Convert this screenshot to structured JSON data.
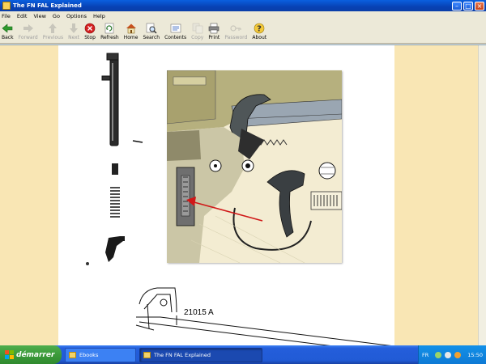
{
  "window": {
    "title": "The FN FAL Explained"
  },
  "menu": [
    "File",
    "Edit",
    "View",
    "Go",
    "Options",
    "Help"
  ],
  "toolbar": [
    {
      "name": "back",
      "label": "Back",
      "icon": "back-arrow-icon",
      "enabled": true
    },
    {
      "name": "forward",
      "label": "Forward",
      "icon": "forward-arrow-icon",
      "enabled": false
    },
    {
      "name": "previous",
      "label": "Previous",
      "icon": "up-arrow-icon",
      "enabled": false
    },
    {
      "name": "next",
      "label": "Next",
      "icon": "down-arrow-icon",
      "enabled": false
    },
    {
      "name": "stop",
      "label": "Stop",
      "icon": "stop-icon",
      "enabled": true
    },
    {
      "name": "refresh",
      "label": "Refresh",
      "icon": "refresh-icon",
      "enabled": true
    },
    {
      "name": "home",
      "label": "Home",
      "icon": "home-icon",
      "enabled": true
    },
    {
      "name": "search",
      "label": "Search",
      "icon": "search-icon",
      "enabled": true
    },
    {
      "name": "contents",
      "label": "Contents",
      "icon": "contents-icon",
      "enabled": true
    },
    {
      "name": "copy",
      "label": "Copy",
      "icon": "copy-icon",
      "enabled": false
    },
    {
      "name": "print",
      "label": "Print",
      "icon": "print-icon",
      "enabled": true
    },
    {
      "name": "password",
      "label": "Password",
      "icon": "key-icon",
      "enabled": false
    },
    {
      "name": "about",
      "label": "About",
      "icon": "about-icon",
      "enabled": true
    }
  ],
  "page": {
    "part_number": "21015 A"
  },
  "taskbar": {
    "start_label": "démarrer",
    "tasks": [
      {
        "label": "Ebooks",
        "active": false
      },
      {
        "label": "The FN FAL Explained",
        "active": true
      }
    ],
    "language": "FR",
    "clock": "15:50"
  },
  "colors": {
    "title_bar": "#0842b4",
    "page_margin": "#f9e6b4",
    "taskbar": "#245edb",
    "start_button": "#3c9a3a",
    "stop_icon": "#d42020",
    "arrow_annotation": "#d01818"
  }
}
